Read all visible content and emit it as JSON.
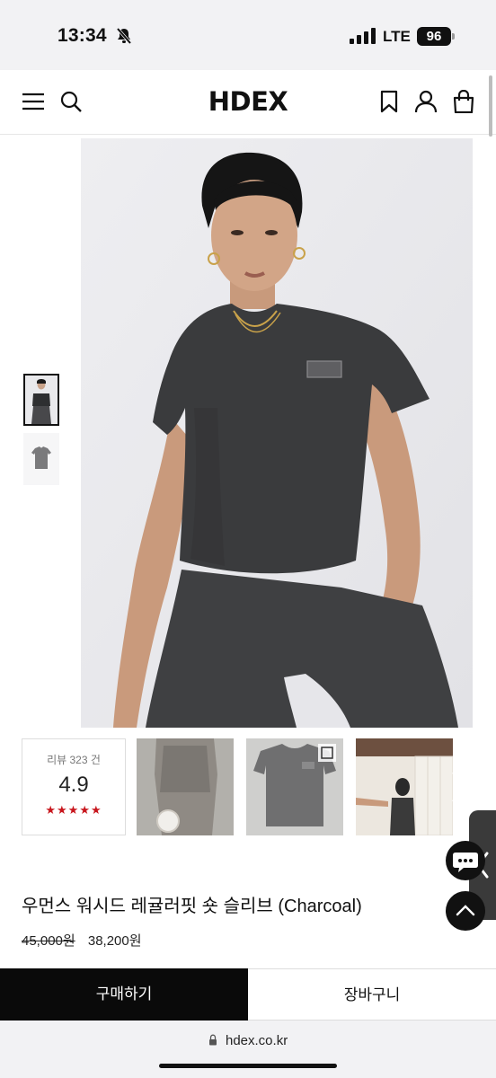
{
  "status_bar": {
    "time": "13:34",
    "network": "LTE",
    "battery": "96"
  },
  "header": {
    "logo": "HDEX",
    "icons": [
      "menu-icon",
      "search-icon",
      "bookmark-icon",
      "user-icon",
      "shopping-bag-icon"
    ]
  },
  "gallery": {
    "thumbnails": [
      "model-front",
      "product-flat"
    ],
    "active_index": 0
  },
  "reviews": {
    "count_label": "리뷰 323 건",
    "score": "4.9",
    "stars": "★★★★★",
    "star_color": "#c8161d"
  },
  "product": {
    "name": "우먼스 워시드 레귤러핏 숏 슬리브 (Charcoal)",
    "original_price": "45,000원",
    "sale_price": "38,200원"
  },
  "actions": {
    "buy_label": "구매하기",
    "cart_label": "장바구니"
  },
  "browser": {
    "url": "hdex.co.kr"
  },
  "colors": {
    "accent_black": "#0a0a0a",
    "star_red": "#c8161d",
    "garment": "#3a3b3d"
  }
}
